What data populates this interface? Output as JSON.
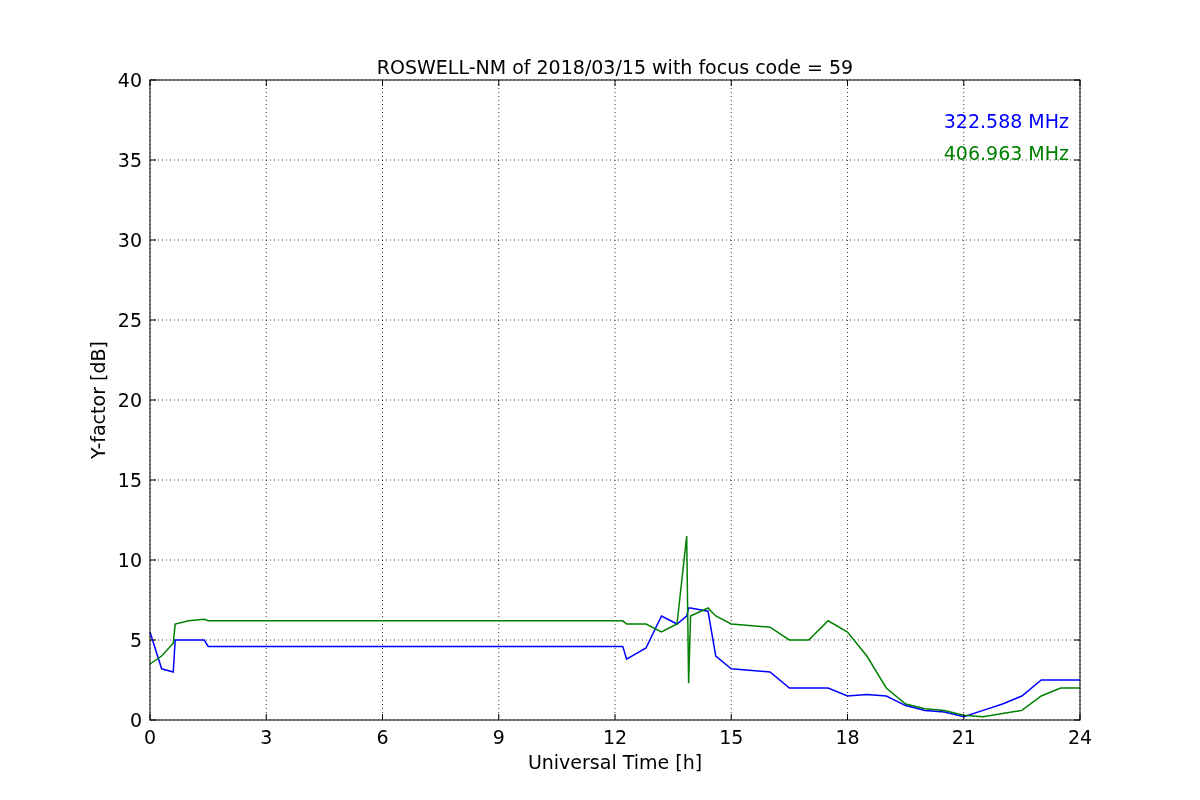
{
  "chart_data": {
    "type": "line",
    "title": "ROSWELL-NM of 2018/03/15 with focus code = 59",
    "xlabel": "Universal Time [h]",
    "ylabel": "Y-factor [dB]",
    "x": [
      0,
      0.3,
      0.6,
      0.65,
      1,
      1.4,
      1.5,
      12.2,
      12.3,
      12.8,
      13.2,
      13.6,
      13.85,
      13.9,
      13.95,
      14.4,
      14.6,
      15,
      16,
      16.5,
      17,
      17.5,
      18,
      18.5,
      19,
      19.5,
      20,
      20.5,
      21,
      21.5,
      22,
      22.5,
      23,
      23.5,
      24
    ],
    "series": [
      {
        "name": "322.588 MHz",
        "color": "#0000ff",
        "values": [
          5.5,
          3.2,
          3,
          5,
          5,
          5,
          4.6,
          4.6,
          3.8,
          4.5,
          6.5,
          6,
          6.5,
          7,
          7,
          6.8,
          4,
          3.2,
          3,
          2,
          2,
          2,
          1.5,
          1.6,
          1.5,
          0.9,
          0.6,
          0.5,
          0.2,
          0.6,
          1,
          1.5,
          2.5,
          2.5,
          2.5
        ]
      },
      {
        "name": "406.963 MHz",
        "color": "#008000",
        "values": [
          3.5,
          4,
          4.8,
          6,
          6.2,
          6.3,
          6.2,
          6.2,
          6,
          6,
          5.5,
          6,
          11.5,
          2.3,
          6.5,
          7,
          6.5,
          6,
          5.8,
          5,
          5,
          6.2,
          5.5,
          4,
          2,
          1,
          0.7,
          0.6,
          0.3,
          0.2,
          0.4,
          0.6,
          1.5,
          2,
          2
        ]
      }
    ],
    "xlim": [
      0,
      24
    ],
    "ylim": [
      0,
      40
    ],
    "xticks": [
      0,
      3,
      6,
      9,
      12,
      15,
      18,
      21,
      24
    ],
    "yticks": [
      0,
      5,
      10,
      15,
      20,
      25,
      30,
      35,
      40
    ],
    "grid": true
  }
}
